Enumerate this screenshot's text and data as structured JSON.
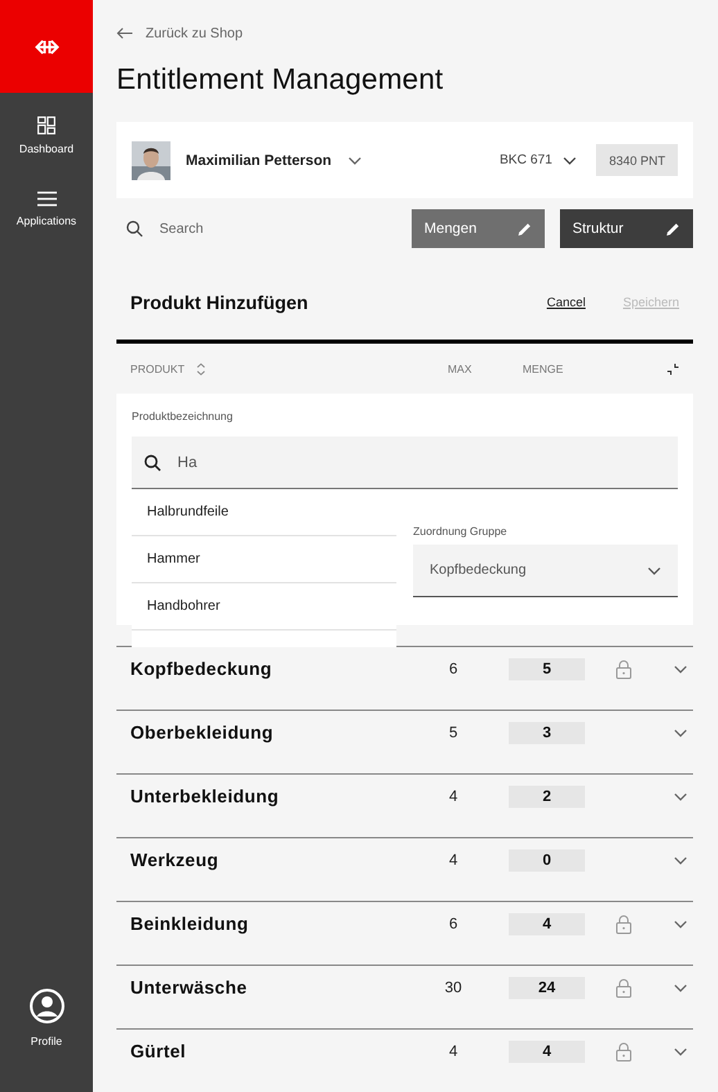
{
  "sidebar": {
    "items": [
      {
        "label": "Dashboard",
        "kind": "dashboard"
      },
      {
        "label": "Applications",
        "kind": "menu"
      }
    ],
    "profile": {
      "label": "Profile"
    }
  },
  "back_link": "Zurück zu Shop",
  "title": "Entitlement Management",
  "user": {
    "name": "Maximilian Petterson",
    "cost_center": "BKC 671",
    "points": "8340 PNT"
  },
  "search": {
    "placeholder": "Search"
  },
  "edit_buttons": [
    {
      "label": "Mengen",
      "kind": "secondary"
    },
    {
      "label": "Struktur",
      "kind": "primary"
    }
  ],
  "add_product": {
    "title": "Produkt Hinzufügen",
    "cancel": "Cancel",
    "save": {
      "label": "Speichern",
      "disabled": true
    },
    "name_field": {
      "label": "Produktbezeichnung",
      "value": "Ha"
    },
    "suggestions": [
      "Halbrundfeile",
      "Hammer",
      "Handbohrer"
    ],
    "group_field": {
      "label": "Zuordnung Gruppe",
      "value": "Kopfbedeckung"
    }
  },
  "table": {
    "columns": [
      "PRODUKT",
      "MAX",
      "MENGE"
    ],
    "rows": [
      {
        "name": "Kopfbedeckung",
        "max": "6",
        "amount": "5",
        "locked": true
      },
      {
        "name": "Oberbekleidung",
        "max": "5",
        "amount": "3",
        "locked": false
      },
      {
        "name": "Unterbekleidung",
        "max": "4",
        "amount": "2",
        "locked": false
      },
      {
        "name": "Werkzeug",
        "max": "4",
        "amount": "0",
        "locked": false
      },
      {
        "name": "Beinkleidung",
        "max": "6",
        "amount": "4",
        "locked": true
      },
      {
        "name": "Unterwäsche",
        "max": "30",
        "amount": "24",
        "locked": true
      },
      {
        "name": "Gürtel",
        "max": "4",
        "amount": "4",
        "locked": true
      }
    ]
  }
}
